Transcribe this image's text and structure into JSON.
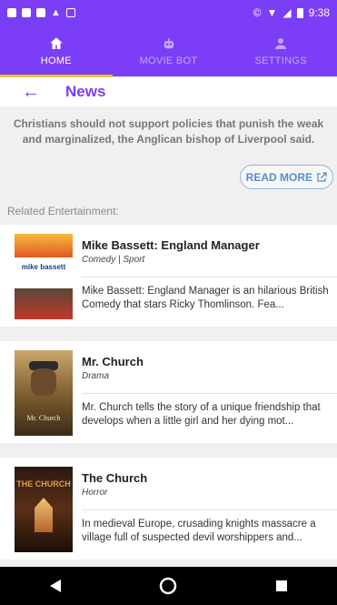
{
  "status_bar": {
    "time": "9:38"
  },
  "nav": {
    "tabs": [
      {
        "label": "HOME",
        "icon": "home-icon",
        "active": true
      },
      {
        "label": "MOVIE BOT",
        "icon": "robot-icon",
        "active": false
      },
      {
        "label": "SETTINGS",
        "icon": "person-icon",
        "active": false
      }
    ],
    "accent_color": "#7b3df5",
    "indicator_color": "#f1c232"
  },
  "header": {
    "title": "News"
  },
  "article": {
    "summary": "Christians should not support policies that punish the weak and marginalized, the Anglican bishop of Liverpool said.",
    "read_more_label": "READ MORE"
  },
  "related": {
    "label": "Related Entertainment:",
    "items": [
      {
        "title": "Mike Bassett: England Manager",
        "genre": "Comedy | Sport",
        "description": "Mike Bassett: England Manager is an hilarious British Comedy that stars Ricky Thomlinson. Fea...",
        "poster_text": "mike bassett"
      },
      {
        "title": "Mr. Church",
        "genre": "Drama",
        "description": "Mr. Church tells the story of a unique friendship that develops when a little girl and her dying mot...",
        "poster_text": "Mr. Church"
      },
      {
        "title": "The Church",
        "genre": "Horror",
        "description": "In medieval Europe, crusading knights massacre a village full of suspected devil worshippers and...",
        "poster_text": "THE CHURCH"
      }
    ]
  }
}
